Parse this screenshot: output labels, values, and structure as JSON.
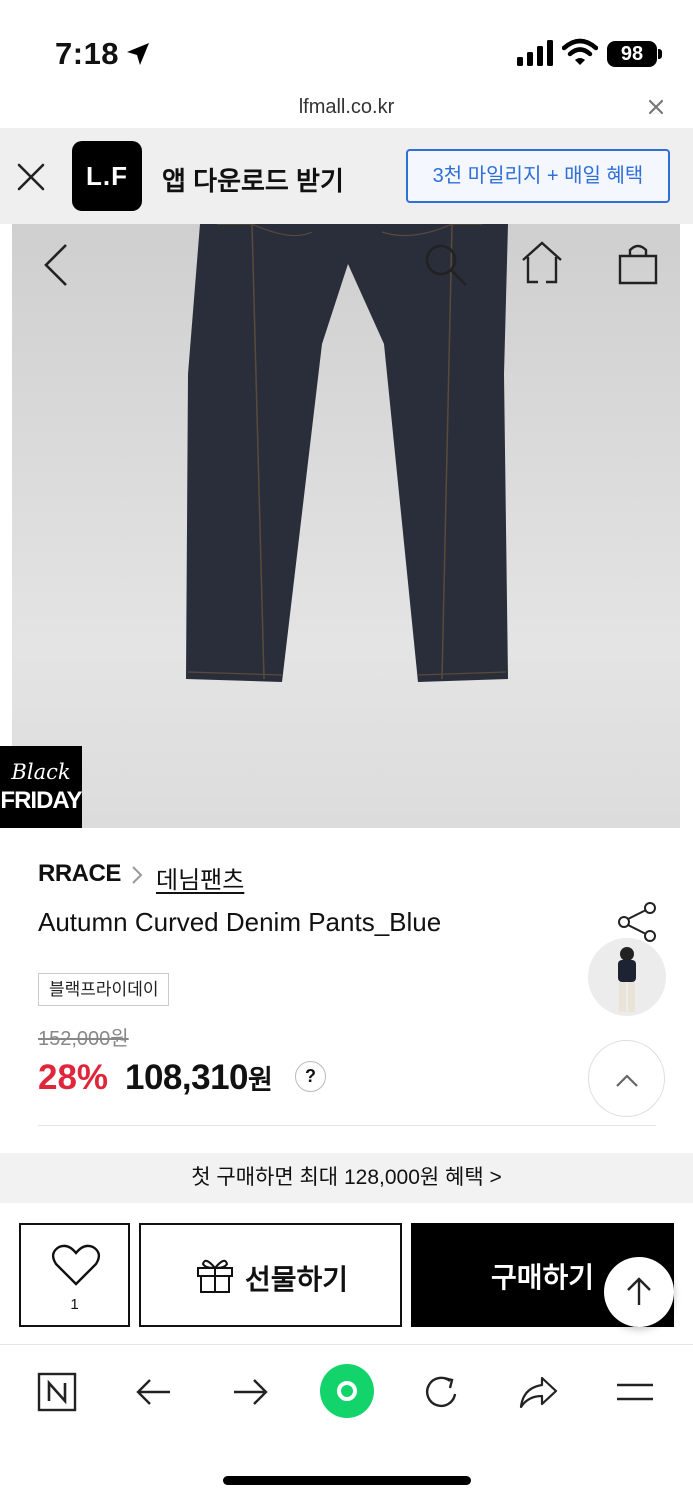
{
  "status_bar": {
    "time": "7:18",
    "battery": "98"
  },
  "browser": {
    "url": "lfmall.co.kr"
  },
  "app_banner": {
    "logo_text": "L.F",
    "title": "앱 다운로드 받기",
    "cta": "3천 마일리지 + 매일 혜택"
  },
  "hero": {
    "badge_line1": "Black",
    "badge_line2": "FRIDAY",
    "icons": [
      "back-icon",
      "search-icon",
      "home-icon",
      "shopping-bag-icon"
    ],
    "slide_indicator": {
      "count": 4,
      "active_index": 2
    }
  },
  "product": {
    "brand": "RRACE",
    "category": "데님팬츠",
    "name": "Autumn Curved Denim Pants_Blue",
    "tag": "블랙프라이데이",
    "original_price": "152,000원",
    "discount": "28%",
    "price": "108,310",
    "price_unit": "원",
    "help": "?"
  },
  "promo": {
    "text": "첫 구매하면 최대 128,000원 혜택 >"
  },
  "actions": {
    "like_count": "1",
    "gift_label": "선물하기",
    "buy_label": "구매하기"
  },
  "toolbar": {
    "icons": [
      "naver-icon",
      "back-arrow-icon",
      "forward-arrow-icon",
      "green-dot-icon",
      "reload-icon",
      "share-icon",
      "menu-icon"
    ]
  },
  "colors": {
    "accent_blue": "#2f6fd8",
    "sale_red": "#e0263a",
    "green": "#13d46a"
  }
}
